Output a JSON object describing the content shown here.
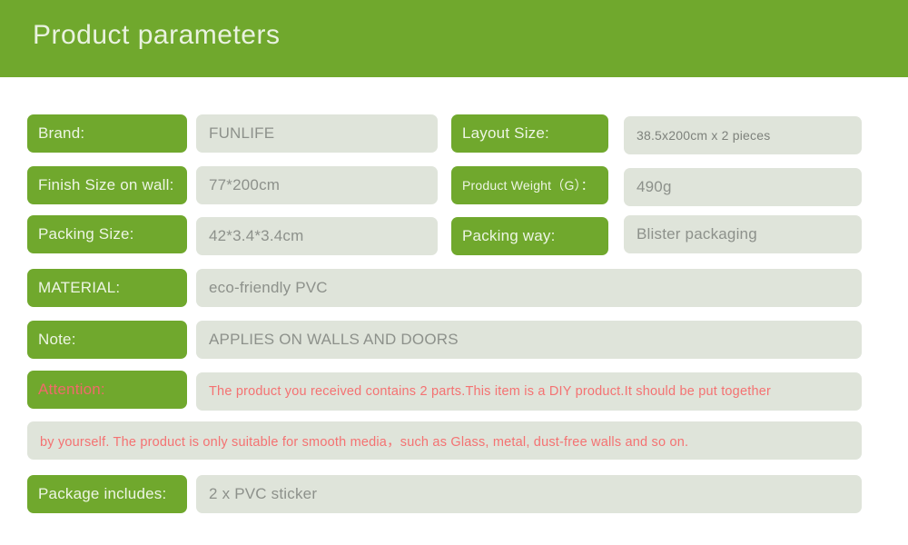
{
  "header": {
    "title": "Product parameters"
  },
  "colors": {
    "green": "#70a82d",
    "value_bg": "#dfe4da",
    "label_text": "#edf5e4",
    "value_text": "#8d918b",
    "alert_text": "#f47272"
  },
  "rows": {
    "brand": {
      "label": "Brand:",
      "value": "FUNLIFE"
    },
    "layout_size": {
      "label": "Layout Size:",
      "value": "38.5x200cm x 2 pieces"
    },
    "finish_size": {
      "label": "Finish Size on wall:",
      "value": "77*200cm"
    },
    "product_weight": {
      "label": "Product Weight（G）：",
      "value": "490g"
    },
    "packing_size": {
      "label": "Packing Size:",
      "value": "42*3.4*3.4cm"
    },
    "packing_way": {
      "label": "Packing way:",
      "value": "Blister packaging"
    },
    "material": {
      "label": "MATERIAL:",
      "value": "eco-friendly PVC"
    },
    "note": {
      "label": "Note:",
      "value": "APPLIES ON WALLS AND DOORS"
    },
    "attention": {
      "label": "Attention:",
      "value_line1": "The product you received contains 2 parts.This item is a DIY product.It should be put together",
      "value_line2": "by yourself. The product is only suitable for smooth media，such as Glass, metal, dust-free walls and so on."
    },
    "package_includes": {
      "label": "Package includes:",
      "value": "2 x PVC sticker"
    }
  }
}
